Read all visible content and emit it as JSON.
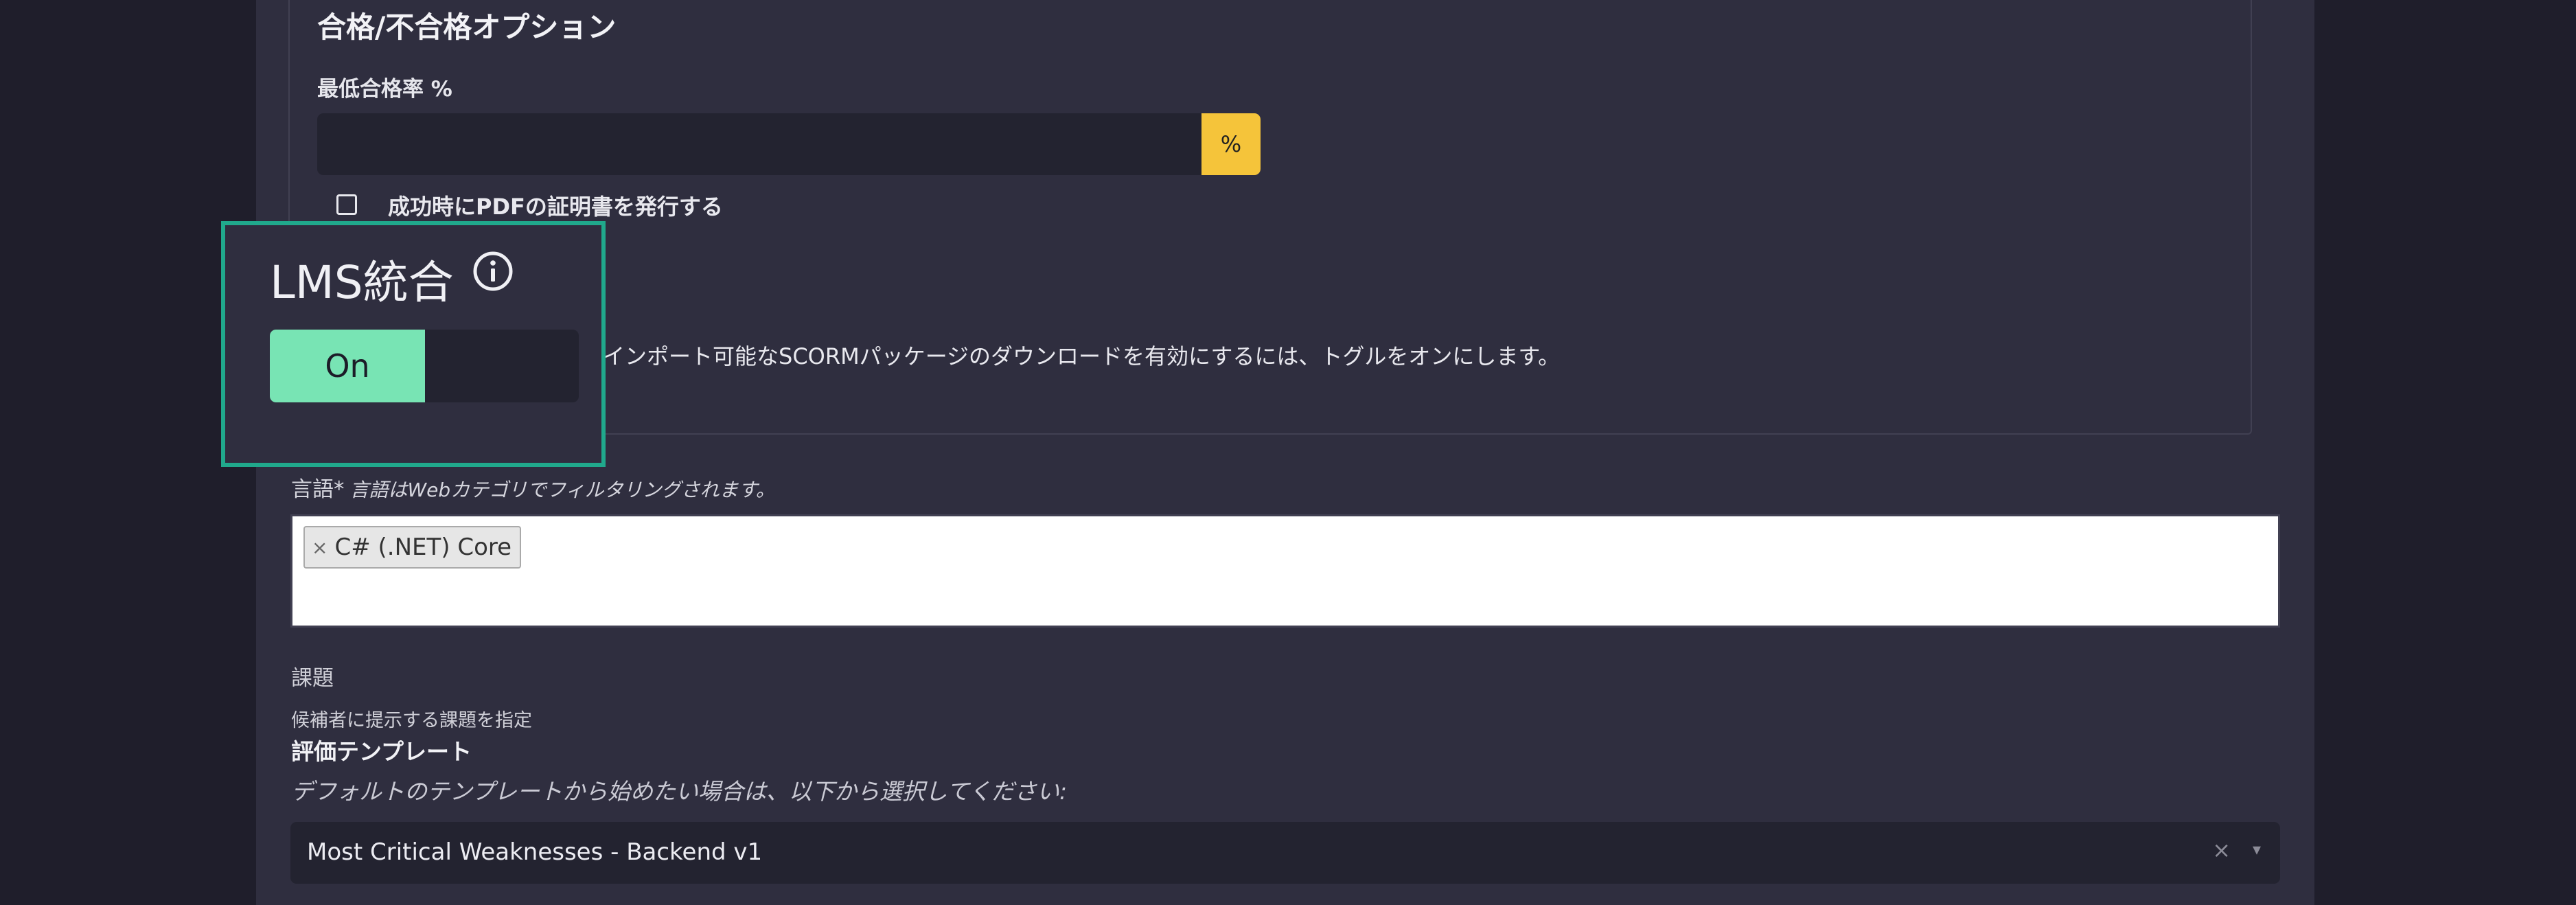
{
  "pass_fail": {
    "title": "合格/不合格オプション",
    "min_pass_rate_label": "最低合格率 %",
    "min_pass_rate_value": "",
    "percent_addon": "%",
    "certificate_checkbox_label": "成功時にPDFの証明書を発行する",
    "certificate_checked": false
  },
  "lms": {
    "title": "LMS統合",
    "toggle_on_label": "On",
    "toggle_state": "on",
    "description": "インポート可能なSCORMパッケージのダウンロードを有効にするには、トグルをオンにします。"
  },
  "language": {
    "label": "言語*",
    "hint": "言語はWebカテゴリでフィルタリングされます。",
    "selected": [
      "C# (.NET) Core"
    ],
    "remove_glyph": "×"
  },
  "tasks": {
    "label": "課題",
    "help": "候補者に提示する課題を指定"
  },
  "template": {
    "label": "評価テンプレート",
    "help": "デフォルトのテンプレートから始めたい場合は、以下から選択してください:",
    "selected": "Most Critical Weaknesses - Backend v1",
    "clear_glyph": "×",
    "caret_glyph": "▾"
  },
  "colors": {
    "accent_yellow": "#f5c43a",
    "toggle_on_green": "#78e4b4",
    "highlight_teal": "#20a98c"
  },
  "icons": {
    "info": "info-circle-icon",
    "checkbox": "checkbox-icon"
  }
}
